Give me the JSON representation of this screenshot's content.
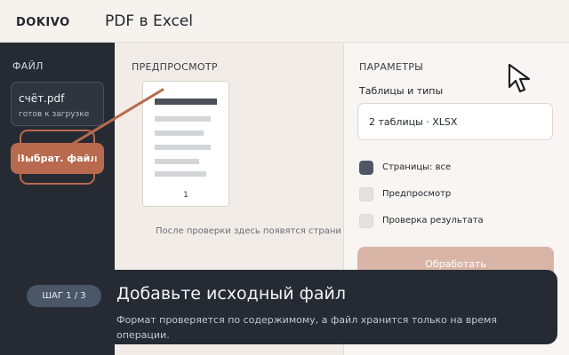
{
  "header": {
    "brand": "DOKIVO",
    "title": "PDF в Excel"
  },
  "sidebar": {
    "section_label": "ФАЙЛ",
    "file": {
      "name": "счёт.pdf",
      "status": "готов к загрузке"
    },
    "choose_button": "Выбрат.  файл"
  },
  "preview": {
    "section_label": "ПРЕДПРОСМОТР",
    "page_number": "1",
    "hint": "После проверки здесь появятся страни"
  },
  "params": {
    "section_label": "ПАРАМЕТРЫ",
    "tables_label": "Таблицы и типы",
    "tables_value": "2 таблицы · XLSX",
    "options": [
      {
        "label": "Страницы: все",
        "checked": true
      },
      {
        "label": "Предпросмотр",
        "checked": false
      },
      {
        "label": "Проверка результата",
        "checked": false
      }
    ],
    "process_button": "Обработать"
  },
  "coach": {
    "step": "ШАГ 1 / 3",
    "title": "Добавьте исходный файл",
    "body": "Формат проверяется по содержимому, а файл хранится только на время операции."
  },
  "colors": {
    "accent": "#b86a4e",
    "dark": "#262b33",
    "checked": "#4e5868",
    "disabled_accent": "#d9b5a8"
  },
  "icons": {
    "cursor": "arrow-cursor-icon"
  }
}
